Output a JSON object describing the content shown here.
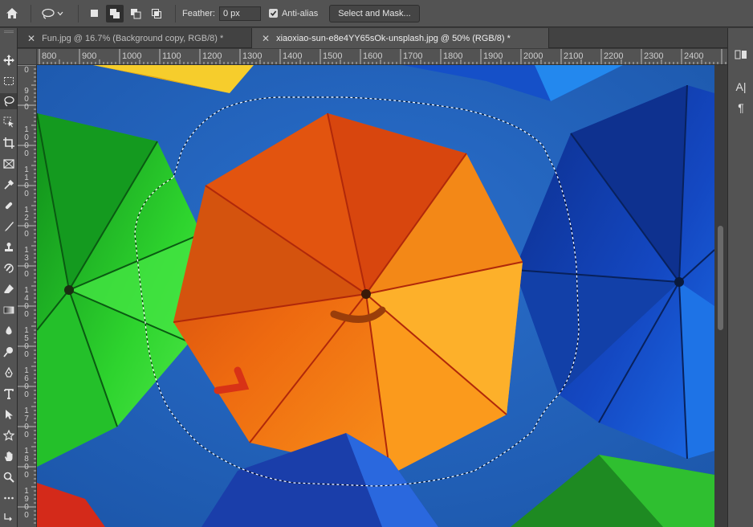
{
  "options_bar": {
    "feather_label": "Feather:",
    "feather_value": "0 px",
    "anti_alias_label": "Anti-alias",
    "anti_alias_checked": true,
    "select_and_mask_label": "Select and Mask..."
  },
  "tabs": [
    {
      "label": "Fun.jpg @ 16.7% (Background copy, RGB/8) *",
      "active": false
    },
    {
      "label": "xiaoxiao-sun-e8e4YY65sOk-unsplash.jpg @ 50% (RGB/8) *",
      "active": true
    }
  ],
  "ruler": {
    "horizontal": [
      "800",
      "900",
      "1000",
      "1100",
      "1200",
      "1300",
      "1400",
      "1500",
      "1600",
      "1700",
      "1800",
      "1900",
      "2000",
      "2100",
      "2200",
      "2300",
      "2400"
    ],
    "vertical": [
      "0",
      "9 0 0",
      "1 0 0 0",
      "1 1 0 0",
      "1 2 0 0",
      "1 3 0 0",
      "1 4 0 0",
      "1 5 0 0",
      "1 6 0 0",
      "1 7 0 0",
      "1 8 0 0",
      "1 9 0 0"
    ]
  },
  "tools": [
    "move-icon",
    "marquee-icon",
    "lasso-icon",
    "object-select-icon",
    "crop-icon",
    "frame-icon",
    "eyedropper-icon",
    "healing-brush-icon",
    "brush-icon",
    "stamp-icon",
    "history-brush-icon",
    "eraser-icon",
    "gradient-icon",
    "blur-icon",
    "dodge-icon",
    "pen-icon",
    "type-icon",
    "path-select-icon",
    "shape-icon",
    "hand-icon",
    "zoom-icon",
    "more-tools-icon",
    "swap-colors-icon"
  ],
  "right_panel": {
    "type_panel_label": "A|",
    "paragraph_panel_label": "¶"
  },
  "colors": {
    "sky": "#1f5fb7",
    "orange_umbrella": "#f07a12",
    "green_umbrella": "#2ecc2e",
    "blue_umbrella": "#1246b8",
    "yellow_umbrella": "#f5c828"
  }
}
